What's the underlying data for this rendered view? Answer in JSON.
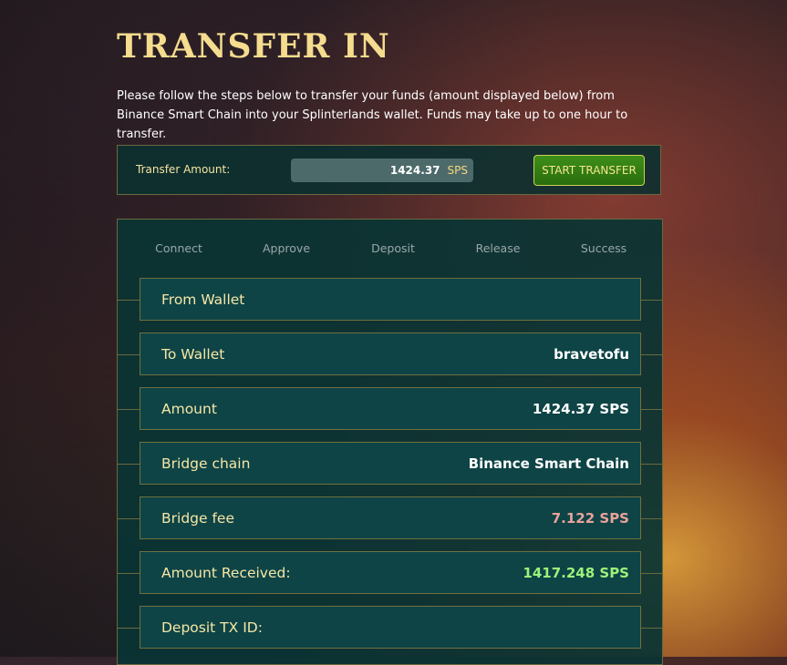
{
  "page": {
    "title": "TRANSFER IN",
    "intro": "Please follow the steps below to transfer your funds (amount displayed below) from Binance Smart Chain into your Splinterlands wallet. Funds may take up to one hour to transfer."
  },
  "transfer": {
    "amount_label": "Transfer Amount:",
    "amount_value": "1424.37",
    "amount_unit": "SPS",
    "start_button": "START TRANSFER"
  },
  "steps": [
    "Connect",
    "Approve",
    "Deposit",
    "Release",
    "Success"
  ],
  "details": [
    {
      "label": "From Wallet",
      "value": ""
    },
    {
      "label": "To Wallet",
      "value": "bravetofu"
    },
    {
      "label": "Amount",
      "value": "1424.37 SPS"
    },
    {
      "label": "Bridge chain",
      "value": "Binance Smart Chain"
    },
    {
      "label": "Bridge fee",
      "value": "7.122 SPS"
    },
    {
      "label": "Amount Received:",
      "value": "1417.248 SPS"
    },
    {
      "label": "Deposit TX ID:",
      "value": ""
    }
  ],
  "colors": {
    "title": "#f5dc8e",
    "panel": "#0e4446",
    "fee": "#e9a39b",
    "received": "#9cf27a",
    "button": "#3d8f18"
  }
}
